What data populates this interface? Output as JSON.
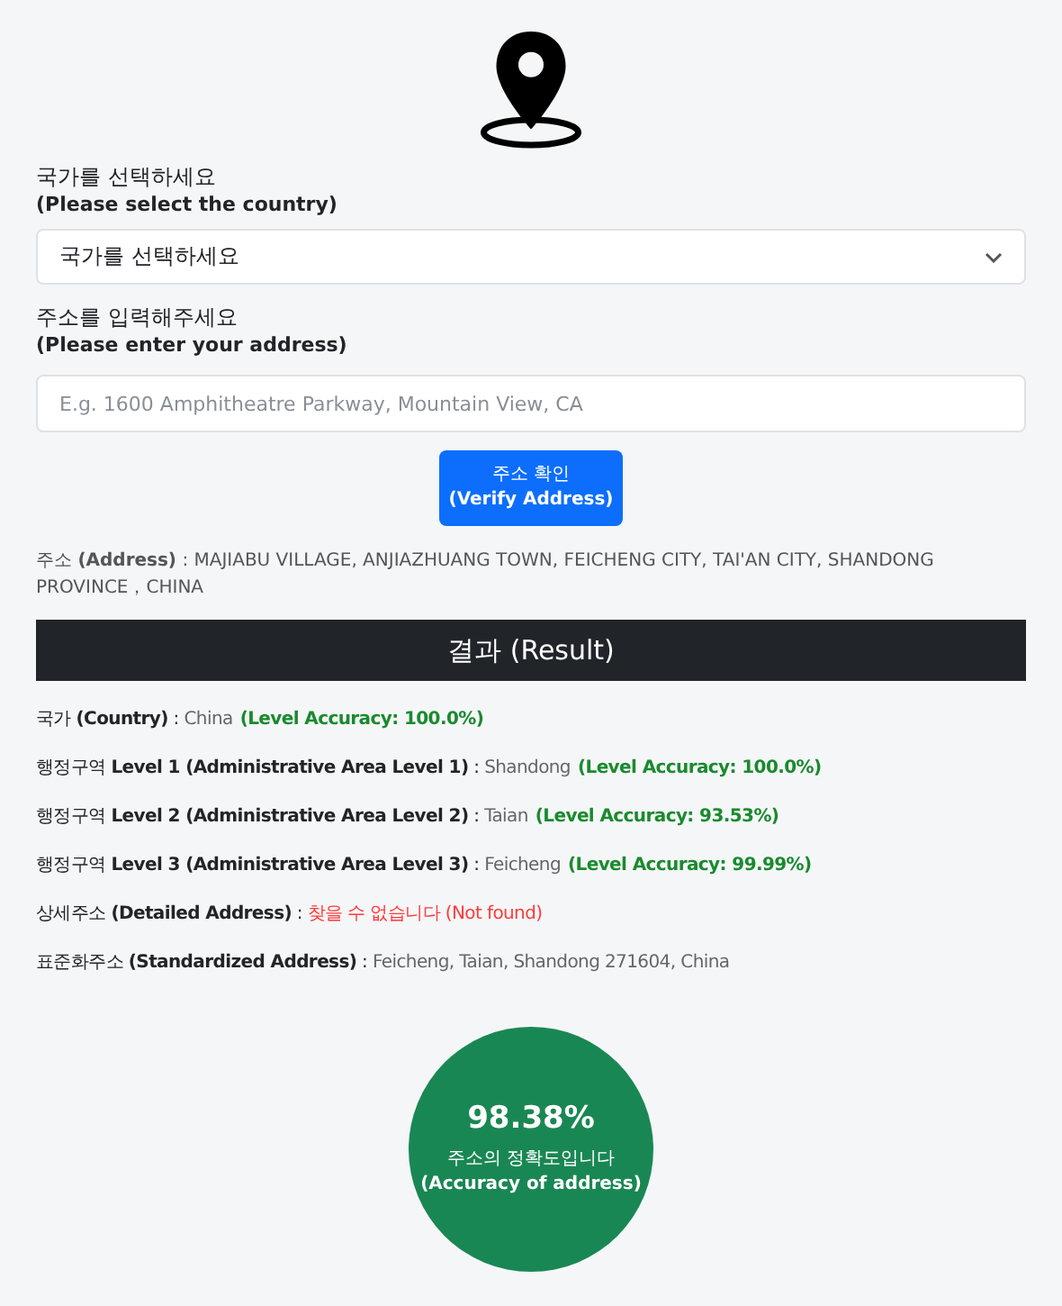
{
  "country_label": {
    "ko": "국가를 선택하세요",
    "en": "(Please select the country)"
  },
  "country_select": {
    "value": "국가를 선택하세요"
  },
  "address_label": {
    "ko": "주소를 입력해주세요",
    "en": "(Please enter your address)"
  },
  "address_input": {
    "placeholder": "E.g. 1600 Amphitheatre Parkway, Mountain View, CA"
  },
  "verify_button": {
    "ko": "주소 확인",
    "en": "(Verify Address)"
  },
  "address_line": "주소 **(Address)** : MAJIABU VILLAGE, ANJIAZHUANG TOWN, FEICHENG CITY, TAI'AN CITY, SHANDONG PROVINCE，CHINA",
  "result_header": "결과 (Result)",
  "results": [
    {
      "label": "국가 **(Country)** :",
      "value": "China",
      "note": "(Level Accuracy: 100.0%)",
      "kind": "accuracy"
    },
    {
      "label": "행정구역 **Level 1 (Administrative Area Level 1)** :",
      "value": "Shandong",
      "note": "(Level Accuracy: 100.0%)",
      "kind": "accuracy"
    },
    {
      "label": "행정구역 **Level 2 (Administrative Area Level 2)** :",
      "value": "Taian",
      "note": "(Level Accuracy: 93.53%)",
      "kind": "accuracy"
    },
    {
      "label": "행정구역 **Level 3 (Administrative Area Level 3)** :",
      "value": "Feicheng",
      "note": "(Level Accuracy: 99.99%)",
      "kind": "accuracy"
    },
    {
      "label": "상세주소 **(Detailed Address)** :",
      "value": "찾을 수 없습니다 (Not found)",
      "kind": "missing"
    },
    {
      "label": "표준화주소 **(Standardized Address)** :",
      "value": "Feicheng, Taian, Shandong 271604, China",
      "kind": "plain"
    }
  ],
  "accuracy": {
    "value": "98.38%",
    "ko": "주소의 정확도입니다",
    "en": "(Accuracy of address)"
  }
}
